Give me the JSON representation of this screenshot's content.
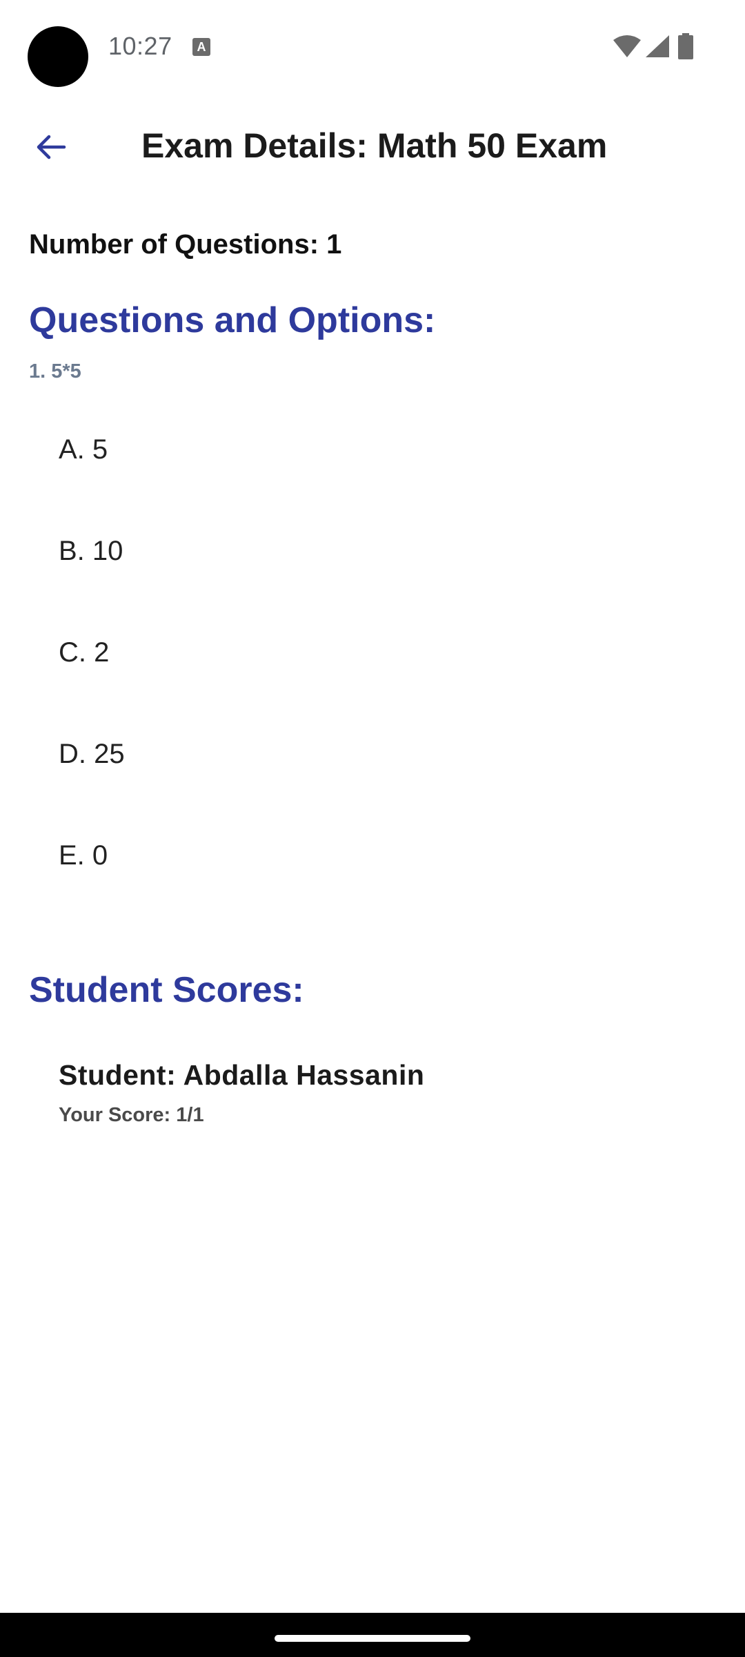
{
  "status_bar": {
    "time": "10:27",
    "notification_icon": "text-a-icon",
    "icons": [
      "wifi-icon",
      "signal-icon",
      "battery-icon"
    ]
  },
  "app_bar": {
    "back_icon": "arrow-back-icon",
    "title": "Exam Details: Math 50 Exam"
  },
  "exam": {
    "number_of_questions": "Number of Questions: 1",
    "questions_heading": "Questions and Options:",
    "questions": [
      {
        "text": "1. 5*5",
        "options": [
          "A. 5",
          "B. 10",
          "C. 2",
          "D. 25",
          "E. 0"
        ]
      }
    ],
    "scores_heading": "Student Scores:",
    "scores": [
      {
        "student": "Student: Abdalla Hassanin",
        "score": "Your Score: 1/1"
      }
    ]
  },
  "colors": {
    "accent": "#2e3a9c",
    "question_text": "#6b7a8f",
    "nav_bar": "#000000"
  }
}
